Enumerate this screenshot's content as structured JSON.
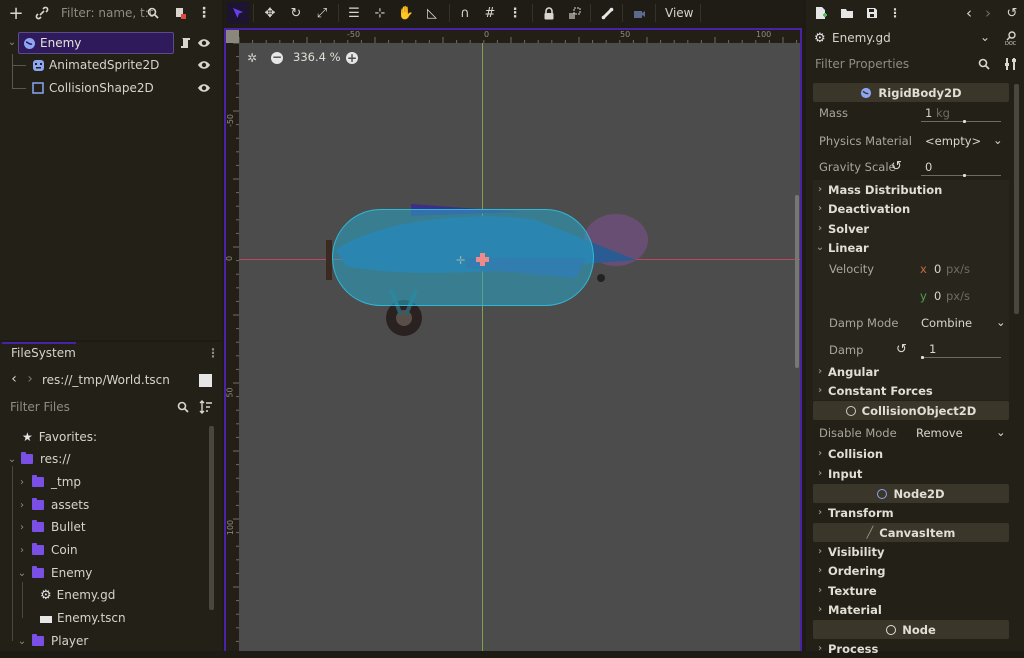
{
  "scene_dock": {
    "filter_placeholder": "Filter: name, t:t",
    "icons": [
      "add-node-icon",
      "link-icon",
      "search-icon",
      "script-icon",
      "menu-icon"
    ],
    "tree": [
      {
        "name": "Enemy",
        "type": "RigidBody2D",
        "selected": true,
        "has_script": true,
        "visible": true
      },
      {
        "name": "AnimatedSprite2D",
        "type": "AnimatedSprite2D",
        "selected": false,
        "visible": true
      },
      {
        "name": "CollisionShape2D",
        "type": "CollisionShape2D",
        "selected": false,
        "visible": true
      }
    ]
  },
  "filesystem": {
    "tab_label": "FileSystem",
    "path": "res://_tmp/World.tscn",
    "filter_placeholder": "Filter Files",
    "items": [
      {
        "label": "Favorites:",
        "kind": "favorites"
      },
      {
        "label": "res://",
        "kind": "folder",
        "expanded": true
      },
      {
        "label": "_tmp",
        "kind": "folder",
        "expanded": false
      },
      {
        "label": "assets",
        "kind": "folder",
        "expanded": false
      },
      {
        "label": "Bullet",
        "kind": "folder",
        "expanded": false
      },
      {
        "label": "Coin",
        "kind": "folder",
        "expanded": false
      },
      {
        "label": "Enemy",
        "kind": "folder",
        "expanded": true
      },
      {
        "label": "Enemy.gd",
        "kind": "script"
      },
      {
        "label": "Enemy.tscn",
        "kind": "scene"
      },
      {
        "label": "Player",
        "kind": "folder",
        "expanded": true
      }
    ]
  },
  "toolbar": {
    "view_label": "View",
    "tools": [
      "select-tool",
      "move-tool",
      "rotate-tool",
      "scale-tool",
      "list-select-tool",
      "pivot-tool",
      "pan-tool",
      "ruler-tool",
      "smart-snap",
      "grid-snap",
      "more-options",
      "lock",
      "group",
      "skeleton",
      "camera"
    ]
  },
  "viewport": {
    "zoom_label": "336.4 %",
    "ruler_top": [
      "-50",
      "0",
      "50",
      "100"
    ],
    "ruler_left": [
      "-50",
      "0",
      "50",
      "100"
    ]
  },
  "inspector": {
    "script_name": "Enemy.gd",
    "filter_placeholder": "Filter Properties",
    "headers": {
      "rigidbody": "RigidBody2D",
      "collision_object": "CollisionObject2D",
      "node2d": "Node2D",
      "canvas_item": "CanvasItem",
      "node": "Node"
    },
    "mass": {
      "label": "Mass",
      "value": "1",
      "unit": "kg",
      "fraction": 0.55
    },
    "physics_material": {
      "label": "Physics Material",
      "value": "<empty>"
    },
    "gravity_scale": {
      "label": "Gravity Scale",
      "value": "0",
      "fraction": 0.55
    },
    "sections_rigid": [
      "Mass Distribution",
      "Deactivation",
      "Solver"
    ],
    "linear": {
      "label": "Linear",
      "velocity_label": "Velocity",
      "x_axis": "x",
      "x_value": "0",
      "y_axis": "y",
      "y_value": "0",
      "unit": "px/s",
      "damp_mode_label": "Damp Mode",
      "damp_mode_value": "Combine",
      "damp_label": "Damp",
      "damp_value": "1",
      "damp_fraction": 0.0
    },
    "sections_after_linear": [
      "Angular",
      "Constant Forces"
    ],
    "disable_mode": {
      "label": "Disable Mode",
      "value": "Remove"
    },
    "sections_collision": [
      "Collision",
      "Input"
    ],
    "sections_node2d": [
      "Transform"
    ],
    "sections_canvas": [
      "Visibility",
      "Ordering",
      "Texture",
      "Material"
    ],
    "sections_node": [
      "Process"
    ]
  },
  "colors": {
    "accent": "#4a22a8",
    "selected_bg": "#2f1a5c",
    "folder": "#7a4fe6",
    "x_axis": "#e06c4a",
    "y_axis": "#5fb35f",
    "collision_shape": "#2aa7c8"
  }
}
